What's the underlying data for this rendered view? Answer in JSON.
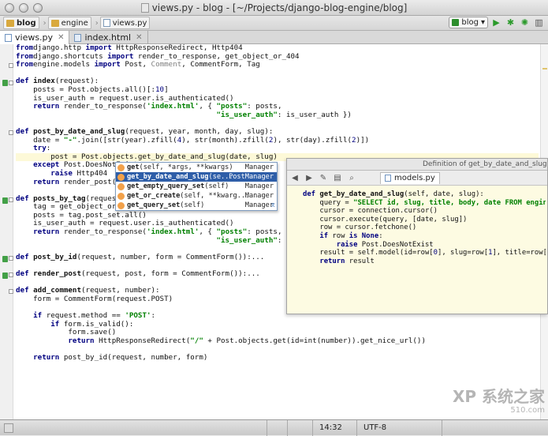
{
  "window": {
    "title": "views.py - blog - [~/Projects/django-blog-engine/blog]"
  },
  "nav": {
    "crumbs": [
      "blog",
      "engine",
      "views.py"
    ],
    "run_config": "blog"
  },
  "tabs": [
    {
      "label": "views.py",
      "active": true
    },
    {
      "label": "index.html",
      "active": false
    }
  ],
  "code_lines": [
    {
      "segs": [
        [
          "kw",
          "from"
        ],
        [
          "",
          "django.http "
        ],
        [
          "kw",
          "import"
        ],
        [
          "",
          " HttpResponseRedirect, Http404"
        ]
      ]
    },
    {
      "segs": [
        [
          "kw",
          "from"
        ],
        [
          "",
          "django.shortcuts "
        ],
        [
          "kw",
          "import"
        ],
        [
          "",
          " render_to_response, get_object_or_404"
        ]
      ]
    },
    {
      "segs": [
        [
          "kw",
          "from"
        ],
        [
          "",
          "engine.models "
        ],
        [
          "kw",
          "import"
        ],
        [
          "",
          " Post, "
        ],
        [
          "gr",
          "Comment"
        ],
        [
          "",
          ", CommentForm, Tag"
        ]
      ]
    },
    {
      "segs": []
    },
    {
      "segs": [
        [
          "kw",
          "def "
        ],
        [
          "fn",
          "index"
        ],
        [
          "",
          "(request):"
        ]
      ]
    },
    {
      "segs": [
        [
          "",
          "    posts = Post.objects.all()[:"
        ],
        [
          "bi",
          "10"
        ],
        [
          "",
          "]"
        ]
      ]
    },
    {
      "segs": [
        [
          "",
          "    is_user_auth = request.user.is_authenticated()"
        ]
      ]
    },
    {
      "segs": [
        [
          "kw",
          "    return"
        ],
        [
          "",
          " render_to_response("
        ],
        [
          "st",
          "'index.html'"
        ],
        [
          "",
          ", { "
        ],
        [
          "st",
          "\"posts\""
        ],
        [
          "",
          ": posts,"
        ]
      ]
    },
    {
      "segs": [
        [
          "",
          "                                              "
        ],
        [
          "st",
          "\"is_user_auth\""
        ],
        [
          "",
          ": is_user_auth })"
        ]
      ]
    },
    {
      "segs": []
    },
    {
      "segs": [
        [
          "kw",
          "def "
        ],
        [
          "fn",
          "post_by_date_and_slug"
        ],
        [
          "",
          "(request, year, month, day, slug):"
        ]
      ]
    },
    {
      "segs": [
        [
          "",
          "    date = "
        ],
        [
          "st",
          "\"-\""
        ],
        [
          "",
          ".join([str(year).zfill("
        ],
        [
          "bi",
          "4"
        ],
        [
          "",
          "), str(month).zfill("
        ],
        [
          "bi",
          "2"
        ],
        [
          "",
          "), str(day).zfill("
        ],
        [
          "bi",
          "2"
        ],
        [
          "",
          ")])"
        ]
      ]
    },
    {
      "segs": [
        [
          "kw",
          "    try"
        ],
        [
          "",
          ":"
        ]
      ]
    },
    {
      "segs": [
        [
          "",
          "        post = Post.objects.get_by_date_and_slug(date, slug)"
        ]
      ],
      "hl": true
    },
    {
      "segs": [
        [
          "kw",
          "    except"
        ],
        [
          "",
          " Post.DoesNotExist:"
        ]
      ]
    },
    {
      "segs": [
        [
          "kw",
          "        raise"
        ],
        [
          "",
          " Http404"
        ]
      ]
    },
    {
      "segs": [
        [
          "kw",
          "    return"
        ],
        [
          "",
          " render_post(request, post)"
        ]
      ]
    },
    {
      "segs": []
    },
    {
      "segs": [
        [
          "kw",
          "def "
        ],
        [
          "fn",
          "posts_by_tag"
        ],
        [
          "",
          "(request, tag):"
        ]
      ]
    },
    {
      "segs": [
        [
          "",
          "    tag = get_object_or_404(Tag, name=tag)"
        ]
      ]
    },
    {
      "segs": [
        [
          "",
          "    posts = tag.post_set.all()"
        ]
      ]
    },
    {
      "segs": [
        [
          "",
          "    is_user_auth = request.user.is_authenticated()"
        ]
      ]
    },
    {
      "segs": [
        [
          "kw",
          "    return"
        ],
        [
          "",
          " render_to_response("
        ],
        [
          "st",
          "'index.html'"
        ],
        [
          "",
          ", { "
        ],
        [
          "st",
          "\"posts\""
        ],
        [
          "",
          ": posts,"
        ]
      ]
    },
    {
      "segs": [
        [
          "",
          "                                              "
        ],
        [
          "st",
          "\"is_user_auth\""
        ],
        [
          "",
          ": is_user_auth })"
        ]
      ]
    },
    {
      "segs": []
    },
    {
      "segs": [
        [
          "kw",
          "def "
        ],
        [
          "fn",
          "post_by_id"
        ],
        [
          "",
          "(request, number, form = CommentForm()):..."
        ]
      ]
    },
    {
      "segs": []
    },
    {
      "segs": [
        [
          "kw",
          "def "
        ],
        [
          "fn",
          "render_post"
        ],
        [
          "",
          "(request, post, form = CommentForm()):..."
        ]
      ]
    },
    {
      "segs": []
    },
    {
      "segs": [
        [
          "kw",
          "def "
        ],
        [
          "fn",
          "add_comment"
        ],
        [
          "",
          "(request, number):"
        ]
      ]
    },
    {
      "segs": [
        [
          "",
          "    form = CommentForm(request.POST)"
        ]
      ]
    },
    {
      "segs": []
    },
    {
      "segs": [
        [
          "kw",
          "    if"
        ],
        [
          "",
          " request.method == "
        ],
        [
          "st",
          "'POST'"
        ],
        [
          "",
          ":"
        ]
      ]
    },
    {
      "segs": [
        [
          "kw",
          "        if"
        ],
        [
          "",
          " form.is_valid():"
        ]
      ]
    },
    {
      "segs": [
        [
          "",
          "            form.save()"
        ]
      ]
    },
    {
      "segs": [
        [
          "kw",
          "            return"
        ],
        [
          "",
          " HttpResponseRedirect("
        ],
        [
          "st",
          "\"/\""
        ],
        [
          "",
          " + Post.objects.get(id=int(number)).get_nice_url())"
        ]
      ]
    },
    {
      "segs": []
    },
    {
      "segs": [
        [
          "kw",
          "    return"
        ],
        [
          "",
          " post_by_id(request, number, form)"
        ]
      ]
    }
  ],
  "completion": {
    "items": [
      {
        "name": "get",
        "sig": "(self, *args, **kwargs)",
        "owner": "Manager"
      },
      {
        "name": "get_by_date_and_slug",
        "sig": "(se...",
        "owner": "PostManager"
      },
      {
        "name": "get_empty_query_set",
        "sig": "(self)",
        "owner": "Manager"
      },
      {
        "name": "get_or_create",
        "sig": "(self, **kwarg...",
        "owner": "Manager"
      },
      {
        "name": "get_query_set",
        "sig": "(self)",
        "owner": "Manager"
      }
    ],
    "selected_index": 1
  },
  "definition": {
    "header": "Definition of get_by_date_and_slug",
    "file_tab": "models.py",
    "lines": [
      {
        "segs": [
          [
            "kw",
            "def "
          ],
          [
            "fn",
            "get_by_date_and_slug"
          ],
          [
            "",
            "(self, date, slug):"
          ]
        ]
      },
      {
        "segs": [
          [
            "",
            "    query = "
          ],
          [
            "st",
            "\"SELECT id, slug, title, body, date FROM engine_po"
          ]
        ]
      },
      {
        "segs": [
          [
            "",
            "    cursor = connection.cursor()"
          ]
        ]
      },
      {
        "segs": [
          [
            "",
            "    cursor.execute(query, [date, slug])"
          ]
        ]
      },
      {
        "segs": [
          [
            "",
            "    row = cursor.fetchone()"
          ]
        ]
      },
      {
        "segs": [
          [
            "kw",
            "    if"
          ],
          [
            "",
            " row "
          ],
          [
            "kw",
            "is None"
          ],
          [
            "",
            ":"
          ]
        ]
      },
      {
        "segs": [
          [
            "kw",
            "        raise"
          ],
          [
            "",
            " Post.DoesNotExist"
          ]
        ]
      },
      {
        "segs": [
          [
            "",
            "    result = self.model(id=row["
          ],
          [
            "bi",
            "0"
          ],
          [
            "",
            "], slug=row["
          ],
          [
            "bi",
            "1"
          ],
          [
            "",
            "], title=row["
          ],
          [
            "bi",
            "2"
          ],
          [
            "",
            "], b"
          ]
        ]
      },
      {
        "segs": [
          [
            "kw",
            "    return"
          ],
          [
            "",
            " result"
          ]
        ]
      }
    ]
  },
  "status": {
    "position": "14:32",
    "encoding": "UTF-8"
  },
  "watermark": {
    "text": "XP 系统之家",
    "sub": "510.com"
  }
}
